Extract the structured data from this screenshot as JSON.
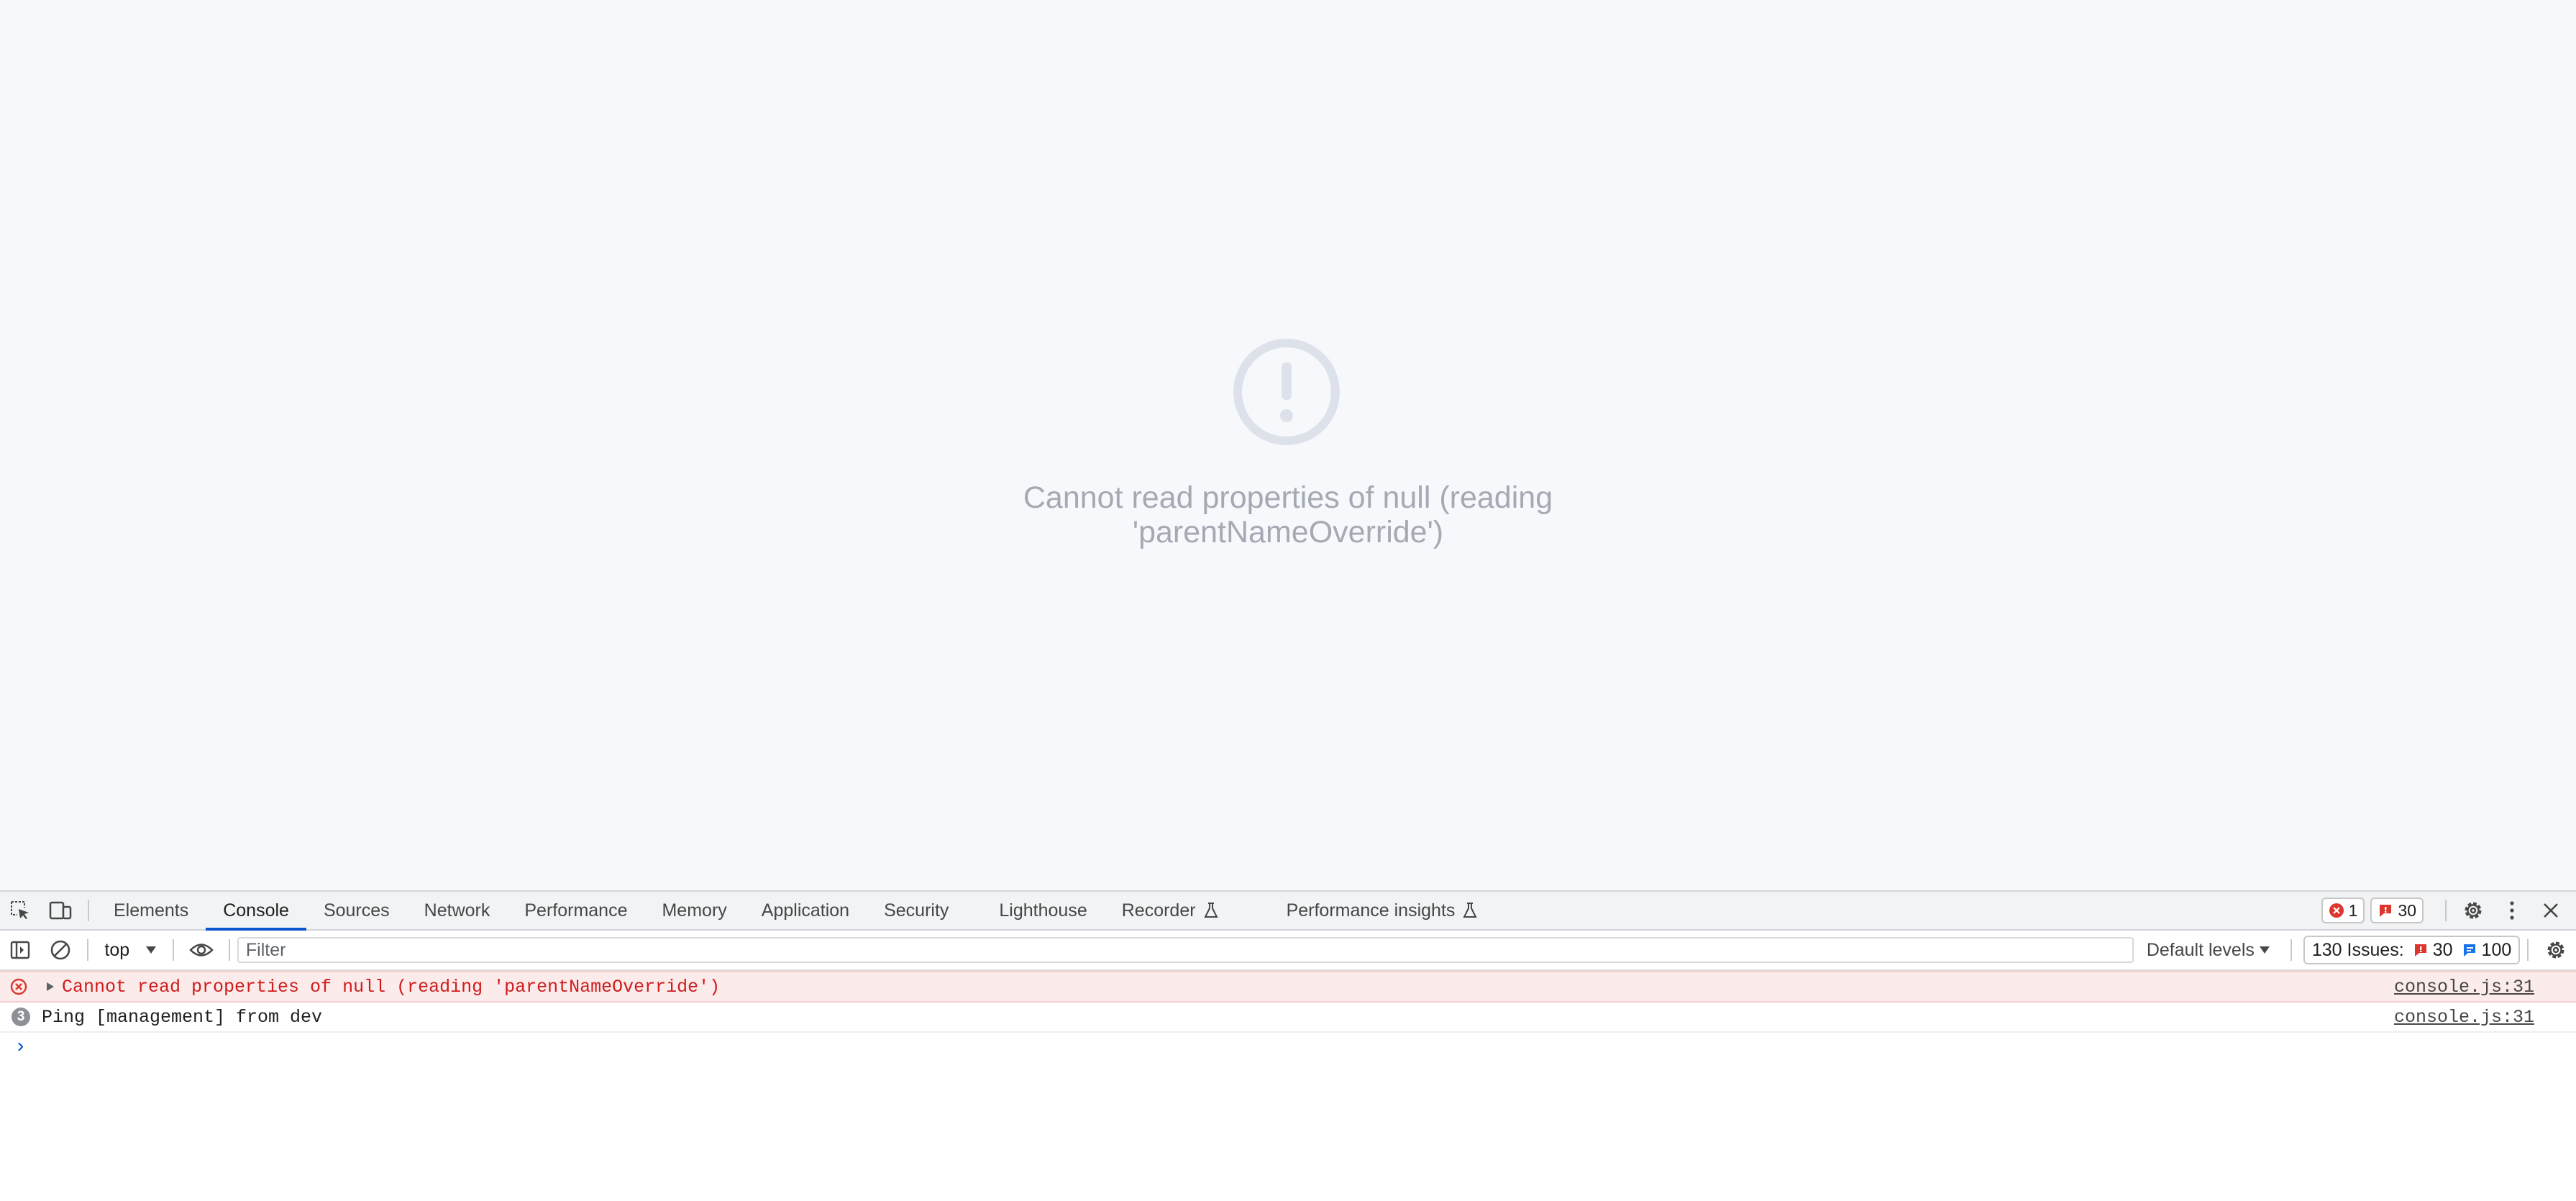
{
  "page": {
    "error_message": "Cannot read properties of null (reading 'parentNameOverride')",
    "error_icon": "exclamation-circle-icon"
  },
  "devtools": {
    "tabs": [
      {
        "label": "Elements"
      },
      {
        "label": "Console",
        "active": true
      },
      {
        "label": "Sources"
      },
      {
        "label": "Network"
      },
      {
        "label": "Performance"
      },
      {
        "label": "Memory"
      },
      {
        "label": "Application"
      },
      {
        "label": "Security"
      },
      {
        "label": "Lighthouse"
      },
      {
        "label": "Recorder",
        "experimental": true
      },
      {
        "label": "Performance insights",
        "experimental": true
      }
    ],
    "error_badge_count": "1",
    "warning_badge_count": "30",
    "toolbar": {
      "context": "top",
      "filter_placeholder": "Filter",
      "levels": "Default levels",
      "issues_label": "130 Issues:",
      "issues_warnings": "30",
      "issues_info": "100"
    },
    "messages": [
      {
        "type": "error",
        "text": "Cannot read properties of null (reading 'parentNameOverride')",
        "source": "console.js:31"
      },
      {
        "type": "info",
        "count": "3",
        "text": "Ping [management] from dev",
        "source": "console.js:31"
      }
    ],
    "prompt_symbol": "›"
  },
  "colors": {
    "error_red": "#d01c1c",
    "accent_blue": "#0b57d0",
    "page_bg": "#f6f8fb"
  }
}
